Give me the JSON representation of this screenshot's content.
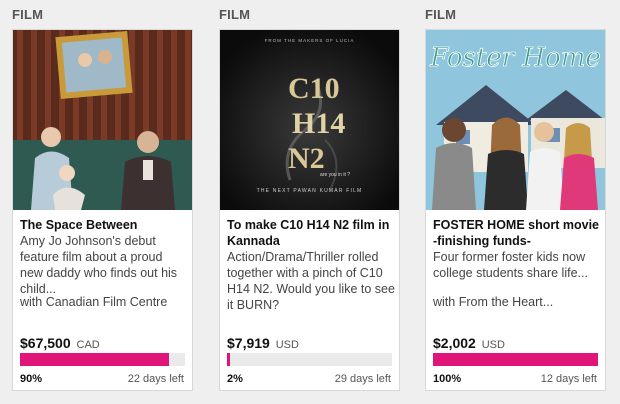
{
  "projects": [
    {
      "category": "FILM",
      "title": "The Space Between",
      "blurb": "Amy Jo Johnson's debut feature film about a proud new daddy who finds out his child...",
      "partner": "with Canadian Film Centre",
      "amount": "$67,500",
      "currency": "CAD",
      "funded_pct": 90,
      "funded_label": "90%",
      "days_left": "22 days left",
      "image": "family-portrait-photo"
    },
    {
      "category": "FILM",
      "title": "To make C10 H14 N2 film in Kannada",
      "blurb": "Action/Drama/Thriller rolled together with a pinch of C10 H14 N2. Would you like to see it BURN?",
      "partner": "",
      "amount": "$7,919",
      "currency": "USD",
      "funded_pct": 2,
      "funded_label": "2%",
      "days_left": "29 days left",
      "image": "movie-poster",
      "poster": {
        "top_text": "FROM THE MAKERS OF LUCIA",
        "formula_lines": [
          "C10",
          "H14",
          "N2"
        ],
        "tagline": "are you in it ?",
        "bottom_text": "THE NEXT PAWAN KUMAR FILM"
      }
    },
    {
      "category": "FILM",
      "title": "FOSTER HOME short movie -finishing funds-",
      "blurb": "Four former foster kids now college students share life...",
      "partner": "with From the Heart...",
      "amount": "$2,002",
      "currency": "USD",
      "funded_pct": 100,
      "funded_label": "100%",
      "days_left": "12 days left",
      "image": "group-photo",
      "overlay_title": "Foster Home"
    }
  ],
  "colors": {
    "progress": "#e0157a",
    "progress_track": "#eaeaea",
    "background": "#efefef"
  }
}
